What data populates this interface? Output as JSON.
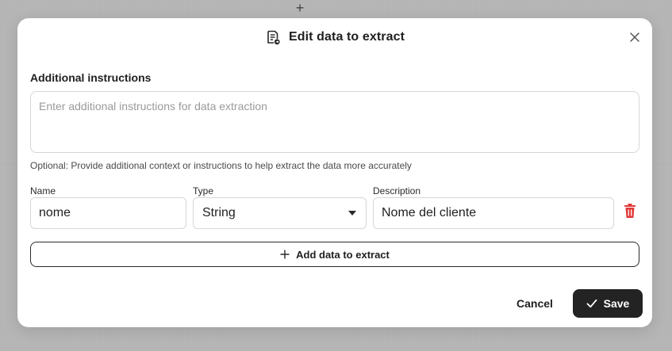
{
  "background": {
    "plus_glyph": "+"
  },
  "dialog": {
    "title": "Edit data to extract",
    "title_icon": "document-extract-icon",
    "close_icon": "close-icon"
  },
  "instructions": {
    "label": "Additional instructions",
    "placeholder": "Enter additional instructions for data extraction",
    "value": "",
    "hint": "Optional: Provide additional context or instructions to help extract the data more accurately"
  },
  "fields": {
    "name_label": "Name",
    "type_label": "Type",
    "description_label": "Description",
    "rows": [
      {
        "name": "nome",
        "type": "String",
        "description": "Nome del cliente"
      }
    ],
    "delete_icon": "trash-icon",
    "delete_color": "#e03a3a"
  },
  "actions": {
    "add_label": "Add data to extract",
    "cancel_label": "Cancel",
    "save_label": "Save",
    "save_bg": "#232323"
  }
}
